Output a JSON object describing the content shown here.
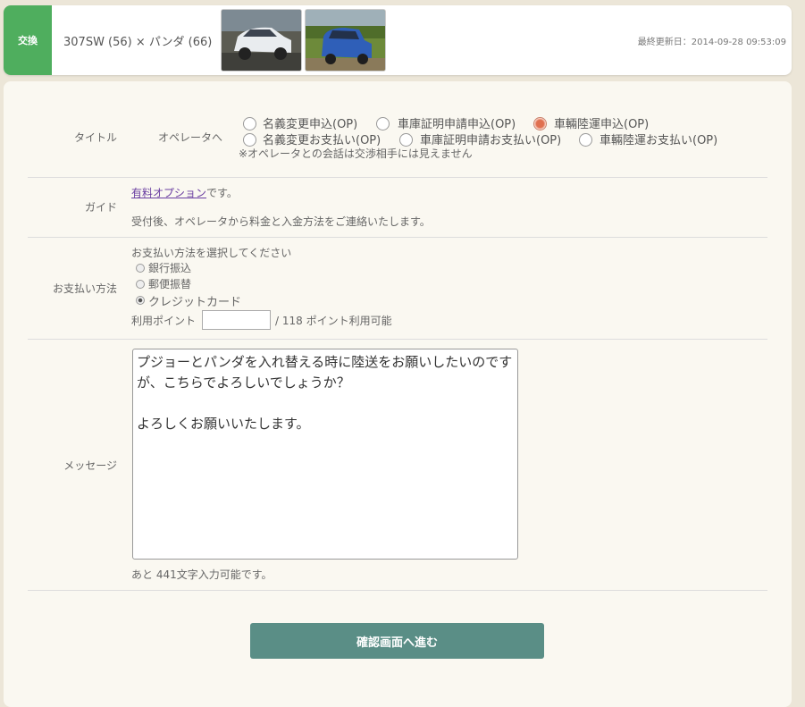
{
  "header": {
    "badge": "交換",
    "trade_title": "307SW (56) × パンダ (66)",
    "updated": "最終更新日：2014-09-28 09:53:09"
  },
  "title_row": {
    "label": "タイトル",
    "sublabel": "オペレータへ",
    "options": [
      {
        "label": "名義変更申込(OP)",
        "checked": false
      },
      {
        "label": "車庫証明申請申込(OP)",
        "checked": false
      },
      {
        "label": "車輛陸運申込(OP)",
        "checked": true
      },
      {
        "label": "名義変更お支払い(OP)",
        "checked": false
      },
      {
        "label": "車庫証明申請お支払い(OP)",
        "checked": false
      },
      {
        "label": "車輛陸運お支払い(OP)",
        "checked": false
      }
    ],
    "note": "※オペレータとの会話は交渉相手には見えません"
  },
  "guide_row": {
    "label": "ガイド",
    "link_text": "有料オプション",
    "link_suffix": "です。",
    "text": "受付後、オペレータから料金と入金方法をご連絡いたします。"
  },
  "payment_row": {
    "label": "お支払い方法",
    "prompt": "お支払い方法を選択してください",
    "methods": [
      {
        "label": "銀行振込",
        "checked": false
      },
      {
        "label": "郵便振替",
        "checked": false
      },
      {
        "label": "クレジットカード",
        "checked": true
      }
    ],
    "points_label": "利用ポイント",
    "points_value": "",
    "points_suffix": "/ 118 ポイント利用可能"
  },
  "message_row": {
    "label": "メッセージ",
    "text": "プジョーとパンダを入れ替える時に陸送をお願いしたいのです\nが、こちらでよろしいでしょうか？\n\nよろしくお願いいたします。",
    "remaining": "あと 441文字入力可能です。"
  },
  "submit": {
    "label": "確認画面へ進む"
  },
  "colors": {
    "badge": "#4fae5e",
    "submit": "#5a8e86",
    "link": "#6a3ea1",
    "radio_checked": "#e07050"
  }
}
